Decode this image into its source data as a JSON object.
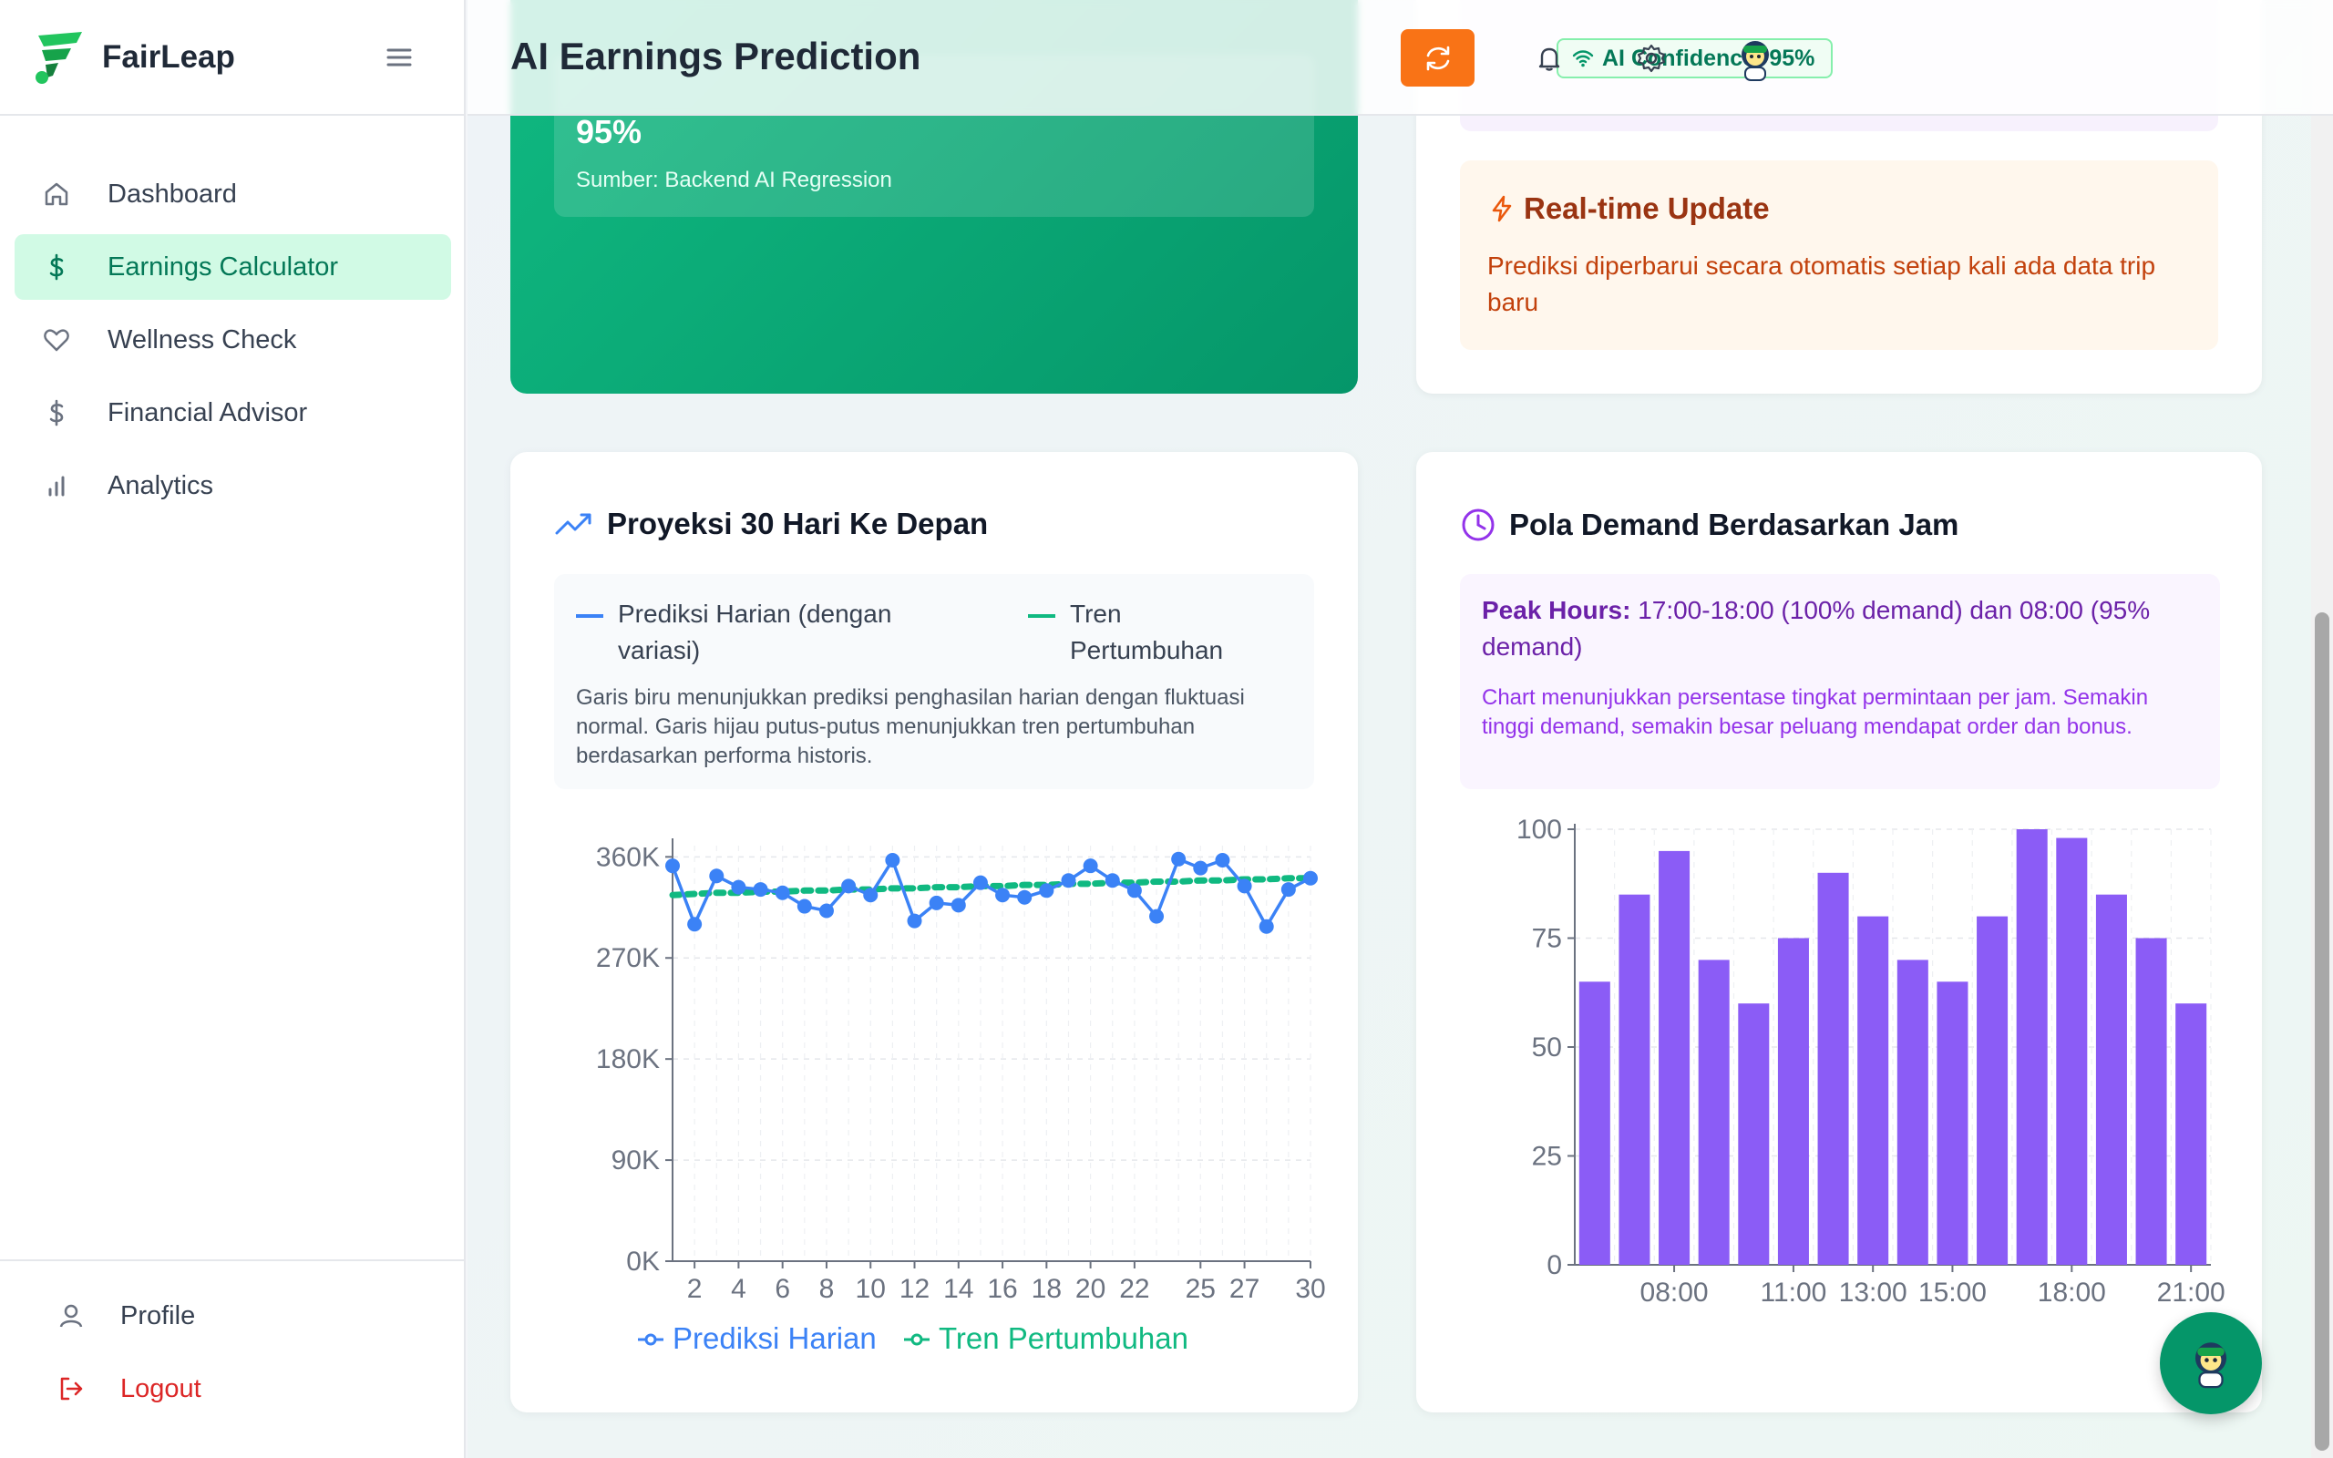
{
  "brand": {
    "name": "FairLeap"
  },
  "sidebar": {
    "items": [
      {
        "label": "Dashboard",
        "icon": "home-icon"
      },
      {
        "label": "Earnings Calculator",
        "icon": "dollar-icon",
        "active": true
      },
      {
        "label": "Wellness Check",
        "icon": "heart-icon"
      },
      {
        "label": "Financial Advisor",
        "icon": "dollar-icon"
      },
      {
        "label": "Analytics",
        "icon": "bar-chart-icon"
      }
    ],
    "bottom": [
      {
        "label": "Profile",
        "icon": "user-icon"
      },
      {
        "label": "Logout",
        "icon": "logout-icon"
      }
    ]
  },
  "header": {
    "title": "AI Earnings Prediction",
    "confidence": "AI Confidence: 95%"
  },
  "green_card": {
    "percent": "95%",
    "source": "Sumber: Backend AI Regression"
  },
  "realtime": {
    "title": "Real-time Update",
    "text": "Prediksi diperbarui secara otomatis setiap kali ada data trip baru"
  },
  "projection": {
    "title": "Proyeksi 30 Hari Ke Depan",
    "legend_daily": "Prediksi Harian (dengan variasi)",
    "legend_trend": "Tren Pertumbuhan",
    "description": "Garis biru menunjukkan prediksi penghasilan harian dengan fluktuasi normal. Garis hijau putus-putus menunjukkan tren pertumbuhan berdasarkan performa historis."
  },
  "demand": {
    "title": "Pola Demand Berdasarkan Jam",
    "peak_label": "Peak Hours:",
    "peak_text": "17:00-18:00 (100% demand) dan 08:00 (95% demand)",
    "description": "Chart menunjukkan persentase tingkat permintaan per jam. Semakin tinggi demand, semakin besar peluang mendapat order dan bonus."
  },
  "colors": {
    "brand_green": "#10b981",
    "line_blue": "#3b82f6",
    "trend_green": "#10b981",
    "bar_purple": "#8b5cf6",
    "refresh_orange": "#f97316"
  },
  "chart_data": [
    {
      "type": "line",
      "x": [
        1,
        2,
        3,
        4,
        5,
        6,
        7,
        8,
        9,
        10,
        11,
        12,
        13,
        14,
        15,
        16,
        17,
        18,
        19,
        20,
        21,
        22,
        23,
        24,
        25,
        26,
        27,
        28,
        29,
        30
      ],
      "x_ticks": [
        "2",
        "4",
        "6",
        "8",
        "10",
        "12",
        "14",
        "16",
        "18",
        "20",
        "22",
        "25",
        "27",
        "30"
      ],
      "y_ticks": [
        "0K",
        "90K",
        "180K",
        "270K",
        "360K"
      ],
      "ylim": [
        0,
        370000
      ],
      "series": [
        {
          "name": "Prediksi Harian",
          "values": [
            352000,
            300000,
            343000,
            333000,
            331000,
            328000,
            316000,
            312000,
            334000,
            326000,
            357000,
            303000,
            319000,
            317000,
            337000,
            326000,
            324000,
            330000,
            339000,
            352000,
            339000,
            330000,
            307000,
            358000,
            350000,
            357000,
            334000,
            298000,
            331000,
            341000
          ]
        },
        {
          "name": "Tren Pertumbuhan",
          "values": [
            326000,
            327000,
            328000,
            328000,
            329000,
            329000,
            330000,
            330000,
            331000,
            331000,
            332000,
            332000,
            333000,
            333000,
            334000,
            334000,
            335000,
            335000,
            336000,
            336000,
            337000,
            337000,
            338000,
            338000,
            339000,
            339000,
            340000,
            340000,
            341000,
            341000
          ]
        }
      ]
    },
    {
      "type": "bar",
      "categories": [
        "06:00",
        "07:00",
        "08:00",
        "09:00",
        "10:00",
        "11:00",
        "12:00",
        "13:00",
        "14:00",
        "15:00",
        "16:00",
        "17:00",
        "18:00",
        "19:00",
        "20:00",
        "21:00"
      ],
      "x_tick_labels": [
        "08:00",
        "11:00",
        "13:00",
        "15:00",
        "18:00",
        "21:00"
      ],
      "values": [
        65,
        85,
        95,
        70,
        60,
        75,
        90,
        80,
        70,
        65,
        80,
        100,
        98,
        85,
        75,
        60
      ],
      "y_ticks": [
        "0",
        "25",
        "50",
        "75",
        "100"
      ],
      "ylim": [
        0,
        100
      ]
    }
  ]
}
